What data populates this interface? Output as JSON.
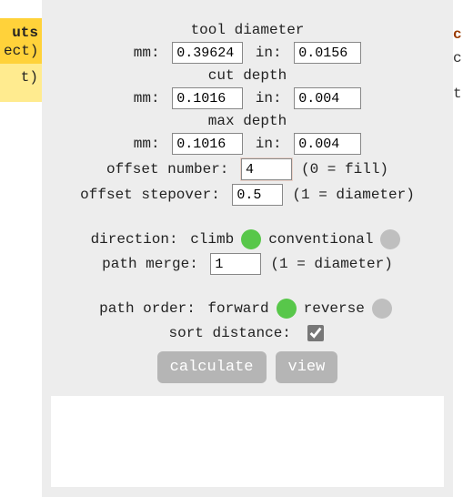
{
  "left": {
    "line1": "uts",
    "line2": "ect)",
    "line3": "t)"
  },
  "right": {
    "c1": "c",
    "c2": "c",
    "c3": "t"
  },
  "titles": {
    "tool_diameter": "tool diameter",
    "cut_depth": "cut depth",
    "max_depth": "max depth"
  },
  "labels": {
    "mm": "mm: ",
    "in": " in: ",
    "offset_number": "offset number: ",
    "offset_note": "(0 = fill)",
    "offset_stepover": "offset stepover: ",
    "stepover_note": "(1 = diameter)",
    "direction": "direction: ",
    "climb": "climb",
    "conventional": "conventional",
    "path_merge": "path merge: ",
    "merge_note": "(1 = diameter)",
    "path_order": "path order: ",
    "forward": "forward",
    "reverse": "reverse",
    "sort_distance": "sort distance: "
  },
  "values": {
    "tool_mm": "0.39624",
    "tool_in": "0.0156",
    "cut_mm": "0.1016",
    "cut_in": "0.004",
    "max_mm": "0.1016",
    "max_in": "0.004",
    "offset_number": "4",
    "offset_stepover": "0.5",
    "path_merge": "1",
    "sort_distance_checked": true
  },
  "buttons": {
    "calculate": "calculate",
    "view": "view"
  }
}
